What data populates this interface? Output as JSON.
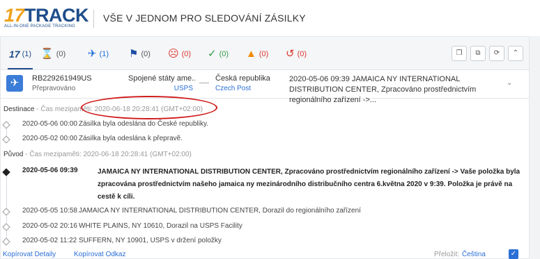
{
  "header": {
    "logo_main_17": "17",
    "logo_main_track": "TRACK",
    "logo_sub": "ALL-IN-ONE PACKAGE TRACKING",
    "title": "VŠE V JEDNOM PRO SLEDOVÁNÍ ZÁSILKY"
  },
  "status_bar": {
    "items": [
      {
        "icon": "17track-logo-icon",
        "count": "(1)"
      },
      {
        "icon": "hourglass-icon",
        "glyph": "⌛",
        "count": "(0)"
      },
      {
        "icon": "airplane-icon",
        "glyph": "✈",
        "count": "(1)"
      },
      {
        "icon": "flag-icon",
        "glyph": "⚑",
        "count": "(0)"
      },
      {
        "icon": "frown-icon",
        "glyph": "☹",
        "count": "(0)"
      },
      {
        "icon": "checkmark-icon",
        "glyph": "✓",
        "count": "(0)"
      },
      {
        "icon": "warning-icon",
        "glyph": "▲",
        "count": "(0)"
      },
      {
        "icon": "history-icon",
        "glyph": "↺",
        "count": "(0)"
      }
    ],
    "tools": [
      {
        "icon": "copy-icon",
        "glyph": "❐"
      },
      {
        "icon": "copy-all-icon",
        "glyph": "⧉"
      },
      {
        "icon": "refresh-icon",
        "glyph": "⟳"
      },
      {
        "icon": "collapse-icon",
        "glyph": "⌃"
      }
    ]
  },
  "colors": {
    "brand_blue": "#1f4e8c",
    "brand_orange": "#f0a21b",
    "link_blue": "#2a6fd6",
    "plane_badge": "#3b7dd8",
    "status_blue": "#1e6fd9",
    "status_red": "#d9362f",
    "status_green": "#2e9b45",
    "status_orange": "#f08a00",
    "annotation_red": "#d01a1a"
  },
  "summary": {
    "tracking_number": "RB229261949US",
    "status": "Přepravováno",
    "origin_country": "Spojené státy ame...",
    "origin_carrier": "USPS",
    "destination_country": "Česká republika",
    "destination_carrier": "Czech Post",
    "latest_event": "2020-05-06 09:39  JAMAICA NY INTERNATIONAL DISTRIBUTION CENTER, Zpracováno prostřednictvím regionálního zařízení ->...",
    "expand_glyph": "⌄"
  },
  "destination": {
    "label": "Destinace",
    "time_label": " - Čas mezipaměti: 2020-06-18 20:28:41 (GMT+02:00)",
    "events": [
      {
        "time": "2020-05-06 00:00",
        "text": "Zásilka byla odeslána do České republiky."
      },
      {
        "time": "2020-05-02 00:00",
        "text": "Zásilka byla odeslána k přepravě."
      }
    ]
  },
  "origin": {
    "label": "Původ",
    "time_label": " - Čas mezipaměti: 2020-06-18 20:28:41 (GMT+02:00)",
    "highlight_event": {
      "time": "2020-05-06 09:39",
      "text": "JAMAICA NY INTERNATIONAL DISTRIBUTION CENTER, Zpracováno prostřednictvím regionálního zařízení -> Vaše položka byla zpracována prostřednictvím našeho jamaica ny mezinárodního distribučního centra 6.května 2020 v 9:39. Položka je právě na cestě k cíli."
    },
    "events": [
      {
        "time": "2020-05-05 10:58",
        "text": "JAMAICA NY INTERNATIONAL DISTRIBUTION CENTER, Dorazil do regionálního zařízení"
      },
      {
        "time": "2020-05-02 20:16",
        "text": "WHITE PLAINS, NY 10610, Dorazil na USPS Facility"
      },
      {
        "time": "2020-05-02 11:22",
        "text": "SUFFERN, NY 10901, USPS v držení položky"
      }
    ]
  },
  "footer": {
    "copy_details": "Kopírovat Detaily",
    "copy_link": "Kopírovat Odkaz",
    "translate_label": "Přeložit:",
    "translate_language": "Čeština",
    "translate_checked": "✓"
  }
}
